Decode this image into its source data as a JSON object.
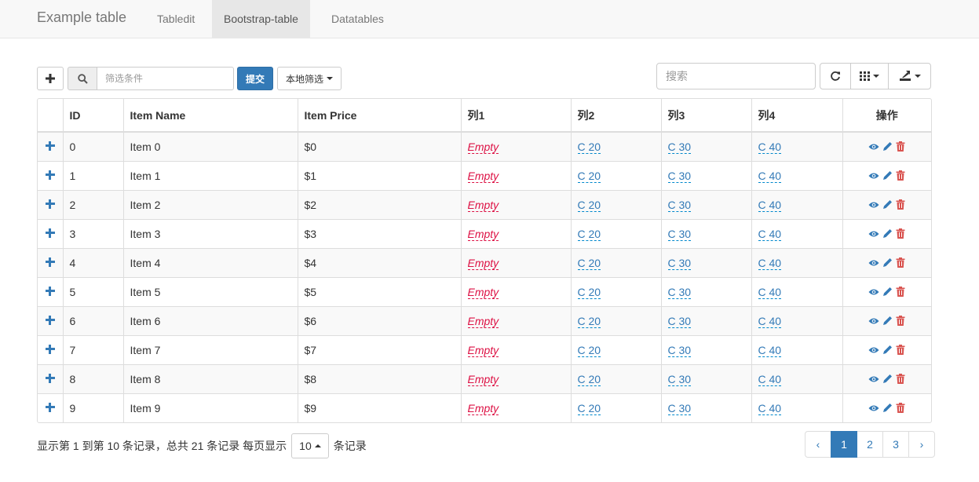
{
  "navbar": {
    "brand": "Example table",
    "items": [
      {
        "label": "Tabledit",
        "active": false
      },
      {
        "label": "Bootstrap-table",
        "active": true
      },
      {
        "label": "Datatables",
        "active": false
      }
    ]
  },
  "toolbar": {
    "add_icon": "plus-icon",
    "search_icon": "search-icon",
    "filter_placeholder": "筛选条件",
    "filter_value": "",
    "submit_label": "提交",
    "local_filter_label": "本地筛选",
    "search_placeholder": "搜索",
    "refresh_icon": "refresh-icon",
    "columns_icon": "grid-icon",
    "export_icon": "export-icon"
  },
  "table": {
    "headers": [
      "ID",
      "Item Name",
      "Item Price",
      "列1",
      "列2",
      "列3",
      "列4",
      "操作"
    ],
    "rows": [
      {
        "id": "0",
        "name": "Item 0",
        "price": "$0",
        "c1": "Empty",
        "c2": "C 20",
        "c3": "C 30",
        "c4": "C 40"
      },
      {
        "id": "1",
        "name": "Item 1",
        "price": "$1",
        "c1": "Empty",
        "c2": "C 20",
        "c3": "C 30",
        "c4": "C 40"
      },
      {
        "id": "2",
        "name": "Item 2",
        "price": "$2",
        "c1": "Empty",
        "c2": "C 20",
        "c3": "C 30",
        "c4": "C 40"
      },
      {
        "id": "3",
        "name": "Item 3",
        "price": "$3",
        "c1": "Empty",
        "c2": "C 20",
        "c3": "C 30",
        "c4": "C 40"
      },
      {
        "id": "4",
        "name": "Item 4",
        "price": "$4",
        "c1": "Empty",
        "c2": "C 20",
        "c3": "C 30",
        "c4": "C 40"
      },
      {
        "id": "5",
        "name": "Item 5",
        "price": "$5",
        "c1": "Empty",
        "c2": "C 20",
        "c3": "C 30",
        "c4": "C 40"
      },
      {
        "id": "6",
        "name": "Item 6",
        "price": "$6",
        "c1": "Empty",
        "c2": "C 20",
        "c3": "C 30",
        "c4": "C 40"
      },
      {
        "id": "7",
        "name": "Item 7",
        "price": "$7",
        "c1": "Empty",
        "c2": "C 20",
        "c3": "C 30",
        "c4": "C 40"
      },
      {
        "id": "8",
        "name": "Item 8",
        "price": "$8",
        "c1": "Empty",
        "c2": "C 20",
        "c3": "C 30",
        "c4": "C 40"
      },
      {
        "id": "9",
        "name": "Item 9",
        "price": "$9",
        "c1": "Empty",
        "c2": "C 20",
        "c3": "C 30",
        "c4": "C 40"
      }
    ],
    "row_icons": [
      "eye-icon",
      "pencil-icon",
      "trash-icon"
    ]
  },
  "footer": {
    "info_text": "显示第 1 到第 10 条记录，总共 21 条记录 每页显示",
    "page_size": "10",
    "suffix": "条记录",
    "pages": [
      "‹",
      "1",
      "2",
      "3",
      "›"
    ],
    "active_page": "1"
  },
  "colors": {
    "primary": "#337ab7",
    "empty_text": "#dd1144",
    "danger": "#d9534f"
  }
}
